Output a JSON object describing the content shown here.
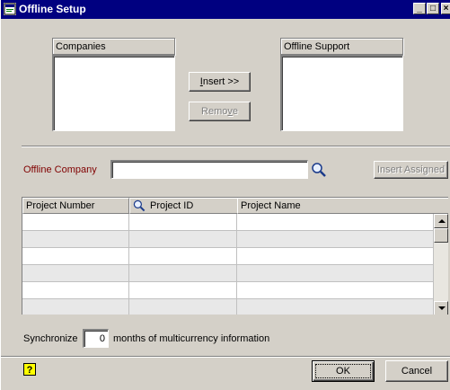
{
  "window": {
    "title": "Offline Setup",
    "minimize": "_",
    "maximize": "□",
    "close": "×"
  },
  "companies": {
    "label": "Companies",
    "items": []
  },
  "offline_support": {
    "label": "Offline Support",
    "items": []
  },
  "buttons": {
    "insert_mnemonic": "I",
    "insert_rest": "nsert >>",
    "remove_pre": "Remo",
    "remove_mnemonic": "v",
    "remove_post": "e",
    "insert_assigned": "Insert Assigned",
    "ok": "OK",
    "cancel": "Cancel"
  },
  "offline_company": {
    "label": "Offline Company",
    "value": ""
  },
  "grid": {
    "columns": [
      "Project Number",
      "Project ID",
      "Project Name"
    ],
    "rows": [
      [
        "",
        "",
        ""
      ],
      [
        "",
        "",
        ""
      ],
      [
        "",
        "",
        ""
      ],
      [
        "",
        "",
        ""
      ],
      [
        "",
        "",
        ""
      ],
      [
        "",
        "",
        ""
      ]
    ]
  },
  "synchronize": {
    "label": "Synchronize",
    "value": "0",
    "suffix": "months of multicurrency information"
  },
  "colors": {
    "titlebar": "#000080",
    "dialog_bg": "#d4d0c8",
    "offline_company_label": "#800000",
    "help_icon": "#ffff00"
  },
  "icons": {
    "app": "offline-setup-icon",
    "lookup": "magnifier-icon",
    "help": "help-icon"
  }
}
